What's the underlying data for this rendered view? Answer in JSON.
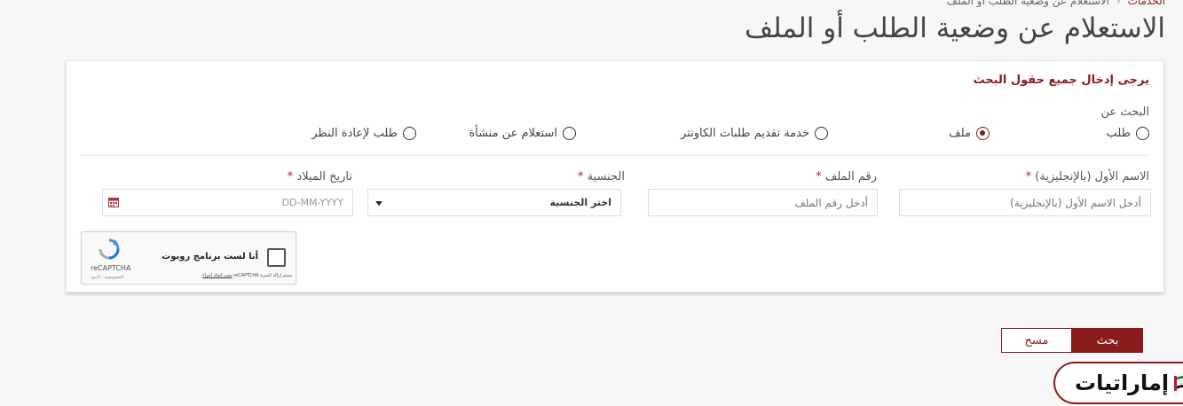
{
  "breadcrumb": {
    "parent": "الخدمات",
    "separator": "‹",
    "current": "الاستعلام عن وضعية الطلب أو الملف"
  },
  "page_title": "الاستعلام عن وضعية الطلب أو الملف",
  "form": {
    "instruction": "يرجى إدخال جميع حقول البحث",
    "search_by_label": "البحث عن",
    "options": [
      {
        "label": "طلب",
        "selected": false
      },
      {
        "label": "ملف",
        "selected": true
      },
      {
        "label": "خدمة تقديم طلبات الكاونتر",
        "selected": false
      },
      {
        "label": "استعلام عن منشأة",
        "selected": false
      },
      {
        "label": "طلب لإعادة النظر",
        "selected": false
      }
    ],
    "fields": {
      "first_name": {
        "label": "الاسم الأول (بالإنجليزية)",
        "placeholder": "أدخل الاسم الأول (بالإنجليزية)"
      },
      "file_number": {
        "label": "رقم الملف",
        "placeholder": "أدخل رقم الملف"
      },
      "nationality": {
        "label": "الجنسية",
        "selected": "اختر الجنسية"
      },
      "dob": {
        "label": "تاريخ الميلاد",
        "placeholder": "DD-MM-YYYY"
      }
    },
    "required_mark": "*"
  },
  "captcha": {
    "checkbox_text": "أنا لست برنامج روبوت",
    "brand": "reCAPTCHA",
    "brand_sub": "الخصوصية - البنود",
    "privacy_text": "reCAPTCHA",
    "privacy_link": "يجب اتخاذ إجراء",
    "privacy_suffix": "ستتم إزالة الميزة"
  },
  "buttons": {
    "search": "بحث",
    "clear": "مسح"
  },
  "brand_badge": {
    "name": "إماراتيات"
  },
  "colors": {
    "accent": "#8a1c1c",
    "background": "#f7f7f7"
  }
}
